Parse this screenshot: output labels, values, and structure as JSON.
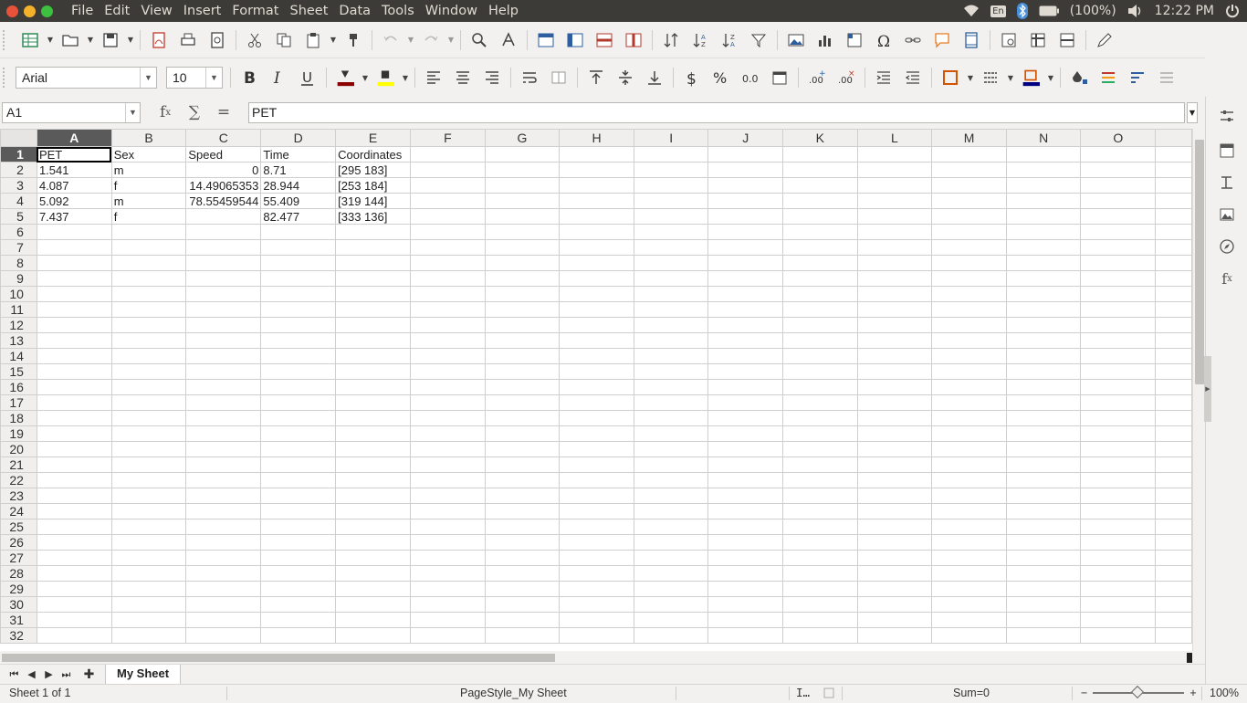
{
  "menubar": {
    "items": [
      "File",
      "Edit",
      "View",
      "Insert",
      "Format",
      "Sheet",
      "Data",
      "Tools",
      "Window",
      "Help"
    ],
    "tray": {
      "keyboard": "En",
      "battery": "(100%)",
      "time": "12:22 PM"
    }
  },
  "toolbar": {
    "font_name": "Arial",
    "font_size": "10"
  },
  "formula": {
    "cell_ref": "A1",
    "content": "PET"
  },
  "sheet": {
    "columns": [
      "A",
      "B",
      "C",
      "D",
      "E",
      "F",
      "G",
      "H",
      "I",
      "J",
      "K",
      "L",
      "M",
      "N",
      "O"
    ],
    "row_numbers": [
      "1",
      "2",
      "3",
      "4",
      "5",
      "6",
      "7",
      "8",
      "9",
      "10",
      "11",
      "12",
      "13",
      "14",
      "15",
      "16",
      "17",
      "18",
      "19",
      "20",
      "21",
      "22",
      "23",
      "24",
      "25",
      "26",
      "27",
      "28",
      "29",
      "30",
      "31",
      "32"
    ],
    "rows": [
      [
        "PET",
        "Sex",
        "Speed",
        "Time",
        "Coordinates"
      ],
      [
        "1.541",
        "m",
        "0",
        "8.71",
        "[295 183]"
      ],
      [
        "4.087",
        "f",
        "14.49065353",
        "28.944",
        "[253 184]"
      ],
      [
        "5.092",
        "m",
        "78.55459544",
        "55.409",
        "[319 144]"
      ],
      [
        "7.437",
        "f",
        "",
        "82.477",
        "[333 136]"
      ]
    ]
  },
  "tabs": {
    "sheet_name": "My Sheet"
  },
  "status": {
    "sheet_info": "Sheet 1 of 1",
    "page_style": "PageStyle_My Sheet",
    "sum": "Sum=0",
    "zoom_minus": "−",
    "zoom_plus": "+",
    "zoom": "100%"
  },
  "colors": {
    "menubar_bg": "#3c3b37",
    "font_color_swatch": "#8b0000",
    "highlight_swatch": "#ffff00",
    "border_swatch": "#000080"
  }
}
